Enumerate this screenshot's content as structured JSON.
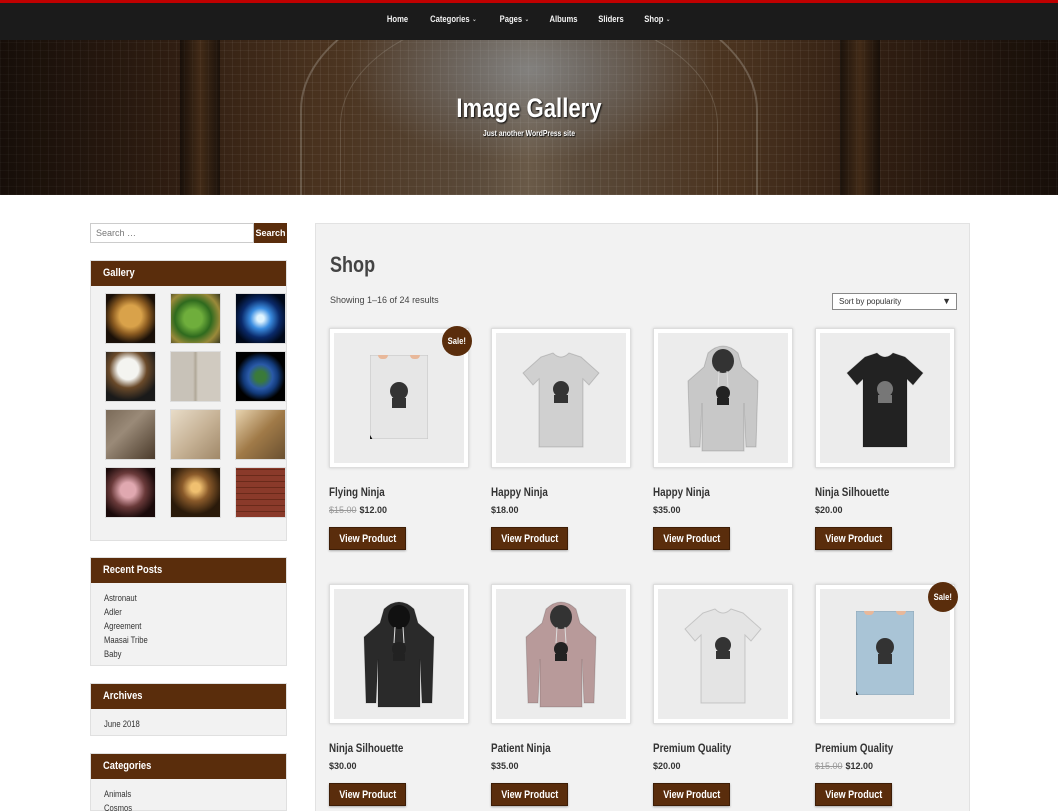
{
  "nav": {
    "items": [
      {
        "label": "Home",
        "has_caret": false
      },
      {
        "label": "Categories",
        "has_caret": true
      },
      {
        "label": "Pages",
        "has_caret": true
      },
      {
        "label": "Albums",
        "has_caret": false
      },
      {
        "label": "Sliders",
        "has_caret": false
      },
      {
        "label": "Shop",
        "has_caret": true
      }
    ],
    "caret_icon": "chevron-down-icon"
  },
  "hero": {
    "title": "Image Gallery",
    "description": "Just another WordPress site"
  },
  "sidebar": {
    "search": {
      "placeholder": "Search …",
      "value": "",
      "button_label": "Search"
    },
    "gallery": {
      "title": "Gallery",
      "thumb_count": 12
    },
    "recent_posts": {
      "title": "Recent Posts",
      "items": [
        "Astronaut",
        "Adler",
        "Agreement",
        "Maasai Tribe",
        "Baby"
      ]
    },
    "archives": {
      "title": "Archives",
      "items": [
        "June 2018"
      ]
    },
    "categories": {
      "title": "Categories",
      "items": [
        "Animals",
        "Cosmos"
      ]
    }
  },
  "main": {
    "title": "Shop",
    "result_count": "Showing 1–16 of 24 results",
    "sort": {
      "selected": "Sort by popularity"
    },
    "products": [
      {
        "name": "Flying Ninja",
        "old_price": "$15.00",
        "price": "$12.00",
        "sale": true,
        "sale_label": "Sale!",
        "image": "poster",
        "button": "View Product"
      },
      {
        "name": "Happy Ninja",
        "old_price": "",
        "price": "$18.00",
        "sale": false,
        "image": "tee-light",
        "button": "View Product"
      },
      {
        "name": "Happy Ninja",
        "old_price": "",
        "price": "$35.00",
        "sale": false,
        "image": "hoodie-grey",
        "button": "View Product"
      },
      {
        "name": "Ninja Silhouette",
        "old_price": "",
        "price": "$20.00",
        "sale": false,
        "image": "tee-dark",
        "button": "View Product"
      },
      {
        "name": "Ninja Silhouette",
        "old_price": "",
        "price": "$30.00",
        "sale": false,
        "image": "hoodie-dark",
        "button": "View Product"
      },
      {
        "name": "Patient Ninja",
        "old_price": "",
        "price": "$35.00",
        "sale": false,
        "image": "hoodie-pink",
        "button": "View Product"
      },
      {
        "name": "Premium Quality",
        "old_price": "",
        "price": "$20.00",
        "sale": false,
        "image": "tee-white",
        "button": "View Product"
      },
      {
        "name": "Premium Quality",
        "old_price": "$15.00",
        "price": "$12.00",
        "sale": true,
        "sale_label": "Sale!",
        "image": "poster-blue",
        "button": "View Product"
      }
    ]
  },
  "colors": {
    "accent": "#5a2d0c",
    "topbar": "#1b1b1b",
    "topbar_border": "#c00000",
    "panel": "#f2f2f2"
  }
}
